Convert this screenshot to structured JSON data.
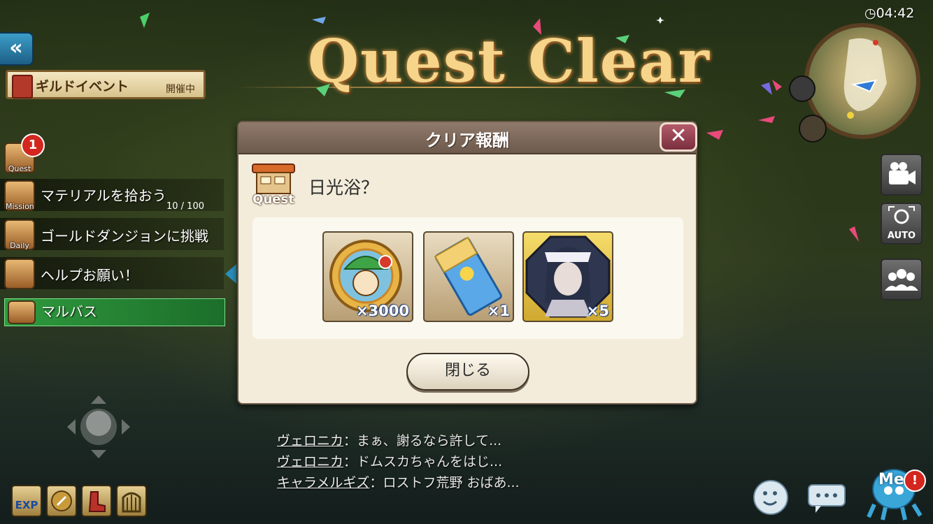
{
  "title": "Quest Clear",
  "timer": "04:42",
  "back_button": {
    "label": "«"
  },
  "guild_banner": {
    "title": "ギルドイベント",
    "status": "開催中"
  },
  "sidebar": {
    "quest": {
      "label": "Quest",
      "badge": "1"
    },
    "missions": [
      {
        "tag": "Mission",
        "text": "マテリアルを拾おう",
        "progress": "10 / 100"
      },
      {
        "tag": "Daily",
        "text": "ゴールドダンジョンに挑戦"
      },
      {
        "tag": "",
        "text": "ヘルプお願い！"
      }
    ],
    "location": {
      "text": "マルバス"
    }
  },
  "dialog": {
    "title": "クリア報酬",
    "close_label": "✕",
    "quest_icon_label": "Quest",
    "quest_name": "日光浴？",
    "rewards": [
      {
        "icon": "gold-coin-icon",
        "qty": "×3000"
      },
      {
        "icon": "ticket-icon",
        "qty": "×1"
      },
      {
        "icon": "character-portrait-icon",
        "qty": "×5"
      }
    ],
    "ok_label": "閉じる"
  },
  "chat": [
    {
      "name": "ヴェロニカ",
      "message": "：まぁ、謝るなら許して..."
    },
    {
      "name": "ヴェロニカ",
      "message": "：ドムスカちゃんをはじ..."
    },
    {
      "name": "キャラメルギズ",
      "message": "：ロストフ荒野 おばあ..."
    }
  ],
  "right_buttons": {
    "camera": "camera-icon",
    "auto_label": "AUTO",
    "party": "party-icon"
  },
  "bottom_left": {
    "exp_label": "EXP"
  },
  "bottom_right": {
    "me_label": "Me",
    "me_badge": "!"
  },
  "colors": {
    "title_gold": "#f6d48a",
    "dialog_bg": "#f3ecdb",
    "header": "#7f6a5c",
    "location_green": "#2f9a3e",
    "badge_red": "#d2261e"
  }
}
